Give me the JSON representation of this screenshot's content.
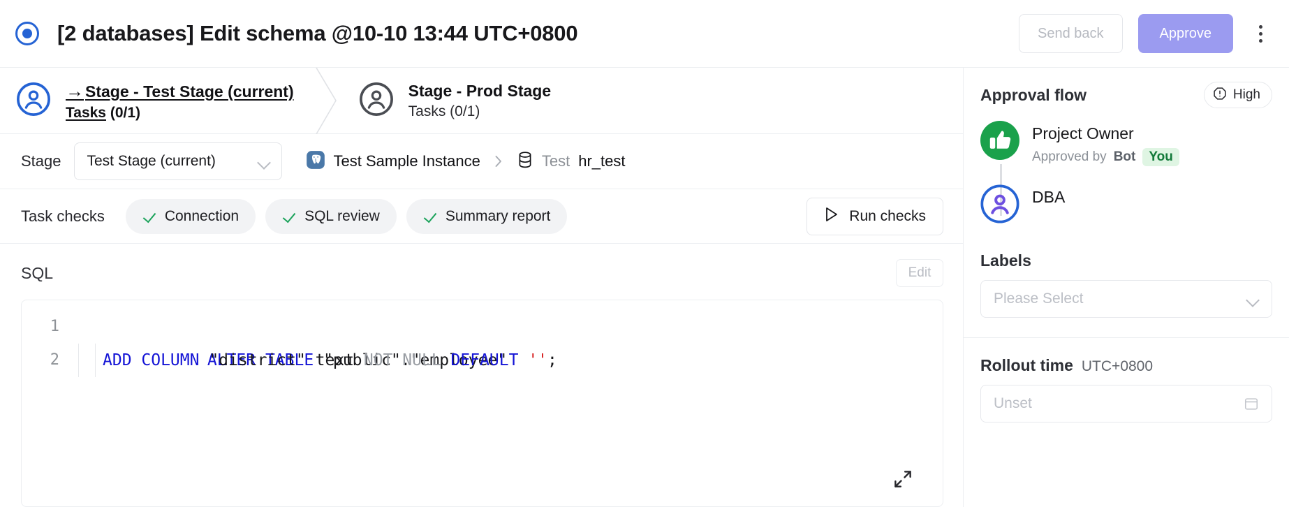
{
  "header": {
    "status_icon": "radio-target-icon",
    "title": "[2 databases] Edit schema @10-10 13:44 UTC+0800",
    "send_back_label": "Send back",
    "approve_label": "Approve",
    "more_icon": "kebab-menu-icon",
    "approve_bg": "#9b9bf0",
    "send_back_color": "#b6b9c0"
  },
  "stages": [
    {
      "arrow": "→",
      "icon": "user-circle-icon",
      "icon_color": "#2563d4",
      "title": "Stage - Test Stage (current)",
      "tasks_label": "Tasks",
      "tasks_count": "(0/1)",
      "active": true
    },
    {
      "arrow": "",
      "icon": "user-circle-icon",
      "icon_color": "#4a4d53",
      "title": "Stage - Prod Stage",
      "tasks_label": "Tasks",
      "tasks_count": "(0/1)",
      "active": false
    }
  ],
  "stage_select": {
    "label": "Stage",
    "value": "Test Stage (current)",
    "chevron_icon": "chevron-down-icon"
  },
  "db_path": {
    "engine_icon": "postgresql-icon",
    "instance": "Test Sample Instance",
    "separator_icon": "chevron-right-icon",
    "database_icon": "database-icon",
    "environment": "Test",
    "database": "hr_test"
  },
  "task_checks": {
    "label": "Task checks",
    "items": [
      {
        "label": "Connection",
        "status_icon": "check-icon",
        "status_color": "#1aa25a"
      },
      {
        "label": "SQL review",
        "status_icon": "check-icon",
        "status_color": "#1aa25a"
      },
      {
        "label": "Summary report",
        "status_icon": "check-icon",
        "status_color": "#1aa25a"
      }
    ],
    "run_label": "Run checks",
    "run_icon": "play-icon"
  },
  "sql": {
    "section_title": "SQL",
    "edit_label": "Edit",
    "expand_icon": "expand-fullscreen-icon",
    "lines": [
      {
        "number": "1",
        "tokens": [
          {
            "t": "ALTER TABLE",
            "c": "kw"
          },
          {
            "t": " ",
            "c": "plain"
          },
          {
            "t": "\"public\".\"employee\"",
            "c": "plain"
          }
        ]
      },
      {
        "number": "2",
        "tokens": [
          {
            "t": "    ",
            "c": "plain"
          },
          {
            "t": "ADD COLUMN",
            "c": "kw"
          },
          {
            "t": " \"district\" text ",
            "c": "plain"
          },
          {
            "t": "NOT NULL",
            "c": "kw2"
          },
          {
            "t": " ",
            "c": "plain"
          },
          {
            "t": "DEFAULT",
            "c": "kw"
          },
          {
            "t": " ",
            "c": "plain"
          },
          {
            "t": "''",
            "c": "str"
          },
          {
            "t": ";",
            "c": "plain"
          }
        ]
      }
    ]
  },
  "approval_flow": {
    "title": "Approval flow",
    "priority": {
      "label": "High",
      "icon": "alert-octagon-icon"
    },
    "steps": [
      {
        "role": "Project Owner",
        "avatar_icon": "thumbs-up-icon",
        "avatar_color": "#1aa14b",
        "meta_prefix": "Approved by",
        "meta_actor": "Bot",
        "badge": "You"
      },
      {
        "role": "DBA",
        "avatar_icon": "user-circle-icon",
        "avatar_color": "#2563d4",
        "meta_prefix": "",
        "meta_actor": "",
        "badge": ""
      }
    ]
  },
  "labels": {
    "title": "Labels",
    "placeholder": "Please Select",
    "chevron_icon": "chevron-down-icon"
  },
  "rollout": {
    "title": "Rollout time",
    "timezone": "UTC+0800",
    "placeholder": "Unset",
    "calendar_icon": "calendar-icon"
  }
}
